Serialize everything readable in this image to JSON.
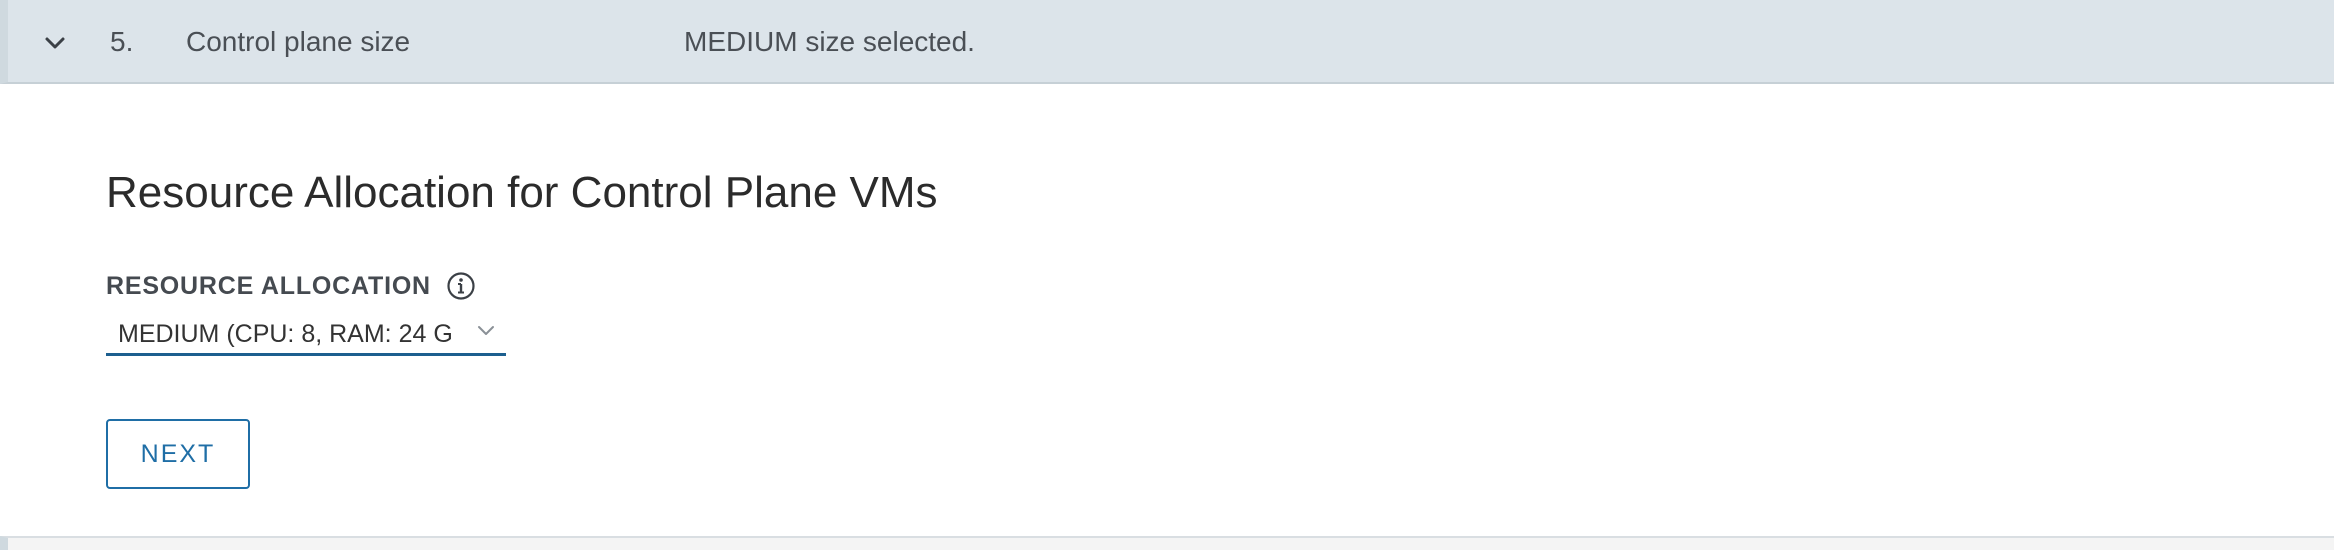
{
  "step": {
    "number": "5.",
    "title": "Control plane size",
    "summary": "MEDIUM size selected.",
    "expand_icon": "chevron-down-icon"
  },
  "section": {
    "title": "Resource Allocation for Control Plane VMs"
  },
  "resource_allocation": {
    "label": "RESOURCE ALLOCATION",
    "info_icon": "info-icon",
    "selected_value": "MEDIUM (CPU: 8, RAM: 24 G",
    "caret_icon": "chevron-down-icon"
  },
  "actions": {
    "next_label": "NEXT"
  },
  "colors": {
    "header_bg": "#dce4ea",
    "accent": "#1f6ea6",
    "select_underline": "#1c5f8f"
  }
}
